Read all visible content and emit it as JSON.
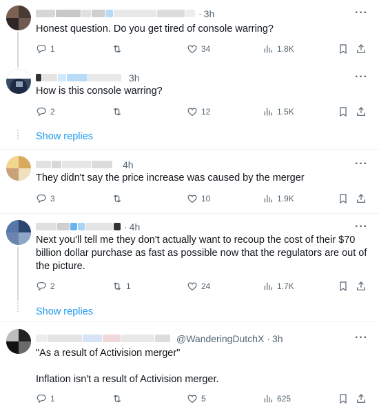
{
  "tweets": [
    {
      "time": "3h",
      "text": "Honest question. Do you get tired of console warring?",
      "replies": "1",
      "likes": "34",
      "views": "1.8K",
      "retweets": ""
    },
    {
      "time": "3h",
      "text": "How is this console warring?",
      "replies": "2",
      "likes": "12",
      "views": "1.5K",
      "retweets": ""
    },
    {
      "time": "4h",
      "text": "They didn't say the price increase was caused by the merger",
      "replies": "3",
      "likes": "10",
      "views": "1.9K",
      "retweets": ""
    },
    {
      "time": "4h",
      "text": "Next you'll tell me they don't actually want to recoup the cost of their $70 billion dollar purchase as fast as possible now that the regulators are out of the picture.",
      "replies": "2",
      "likes": "24",
      "views": "1.7K",
      "retweets": "1"
    },
    {
      "handle": "@WanderingDutchX",
      "time": "3h",
      "text_line1": "\"As a result of Activision merger\"",
      "text_line2": "Inflation isn't a result of Activision merger.",
      "replies": "1",
      "likes": "5",
      "views": "625",
      "retweets": ""
    }
  ],
  "show_replies_label": "Show replies",
  "more_label": "···",
  "sep": "·",
  "icons": [
    "reply-icon",
    "retweet-icon",
    "like-icon",
    "views-icon",
    "bookmark-icon",
    "share-icon"
  ],
  "colors": {
    "link": "#1d9bf0",
    "muted": "#536471",
    "text": "#0f1419"
  }
}
